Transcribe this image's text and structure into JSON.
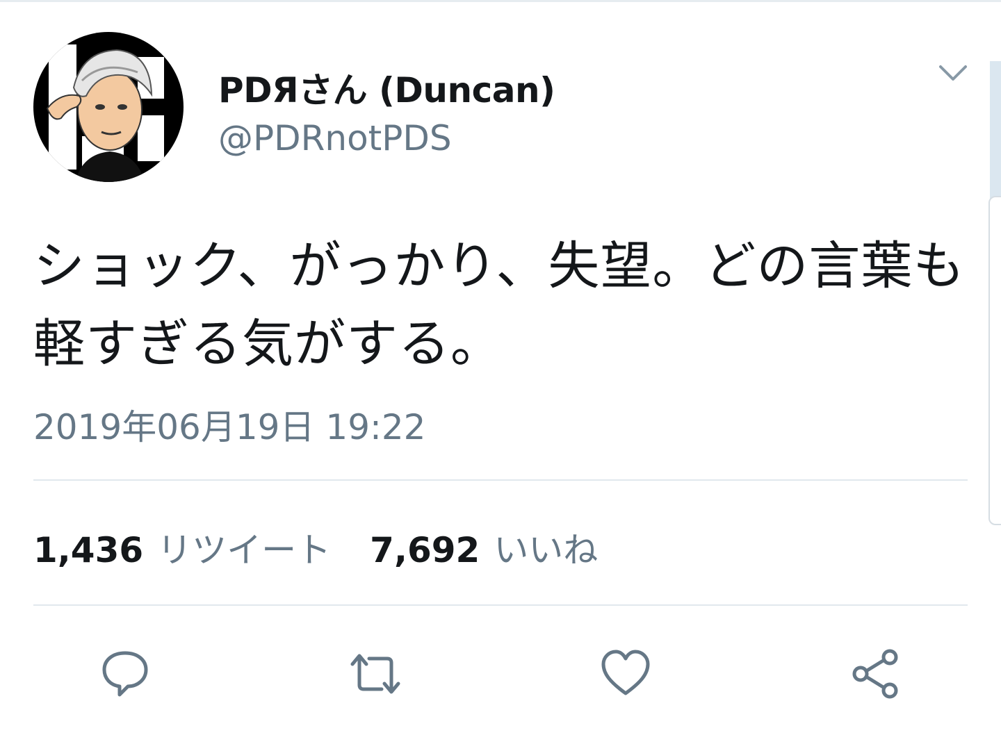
{
  "author": {
    "display_name": "PDЯさん (Duncan)",
    "handle": "@PDRnotPDS",
    "avatar_icon": "illustrated-avatar"
  },
  "tweet": {
    "text": "ショック、がっかり、失望。どの言葉も軽すぎる気がする。",
    "timestamp": "2019年06月19日 19:22"
  },
  "stats": {
    "retweet_count": "1,436",
    "retweet_label": "リツイート",
    "like_count": "7,692",
    "like_label": "いいね"
  },
  "actions": {
    "reply_icon": "reply-icon",
    "retweet_icon": "retweet-icon",
    "like_icon": "heart-icon",
    "share_icon": "share-icon"
  },
  "colors": {
    "text_primary": "#14171a",
    "text_secondary": "#657786",
    "divider": "#e1e8ed"
  }
}
